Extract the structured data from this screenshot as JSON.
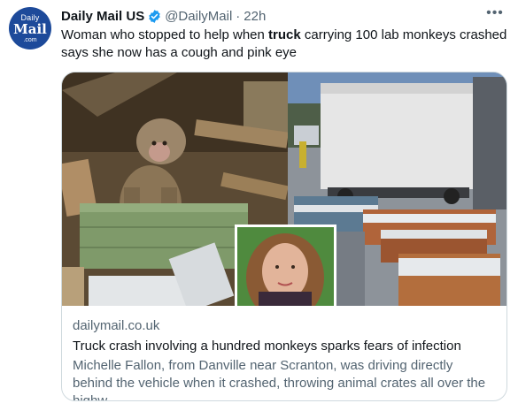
{
  "account": {
    "avatar_lines": [
      "Daily",
      "Mail",
      ".com"
    ],
    "name": "Daily Mail US",
    "handle": "@DailyMail",
    "separator": "·",
    "time": "22h",
    "more_label": "•••"
  },
  "tweet": {
    "text_before": "Woman who stopped to help when ",
    "text_bold": "truck",
    "text_after": " carrying 100 lab monkeys crashed says she now has a cough and pink eye"
  },
  "card": {
    "domain": "dailymail.co.uk",
    "title": "Truck crash involving a hundred monkeys sparks fears of infection",
    "description": "Michelle Fallon, from Danville near Scranton, was driving directly behind the vehicle when it crashed, throwing animal crates all over the highw..."
  },
  "colors": {
    "brand": "#1d4a9a",
    "verified": "#1d9bf0",
    "secondary_text": "#536471",
    "border": "#cfd9de"
  }
}
